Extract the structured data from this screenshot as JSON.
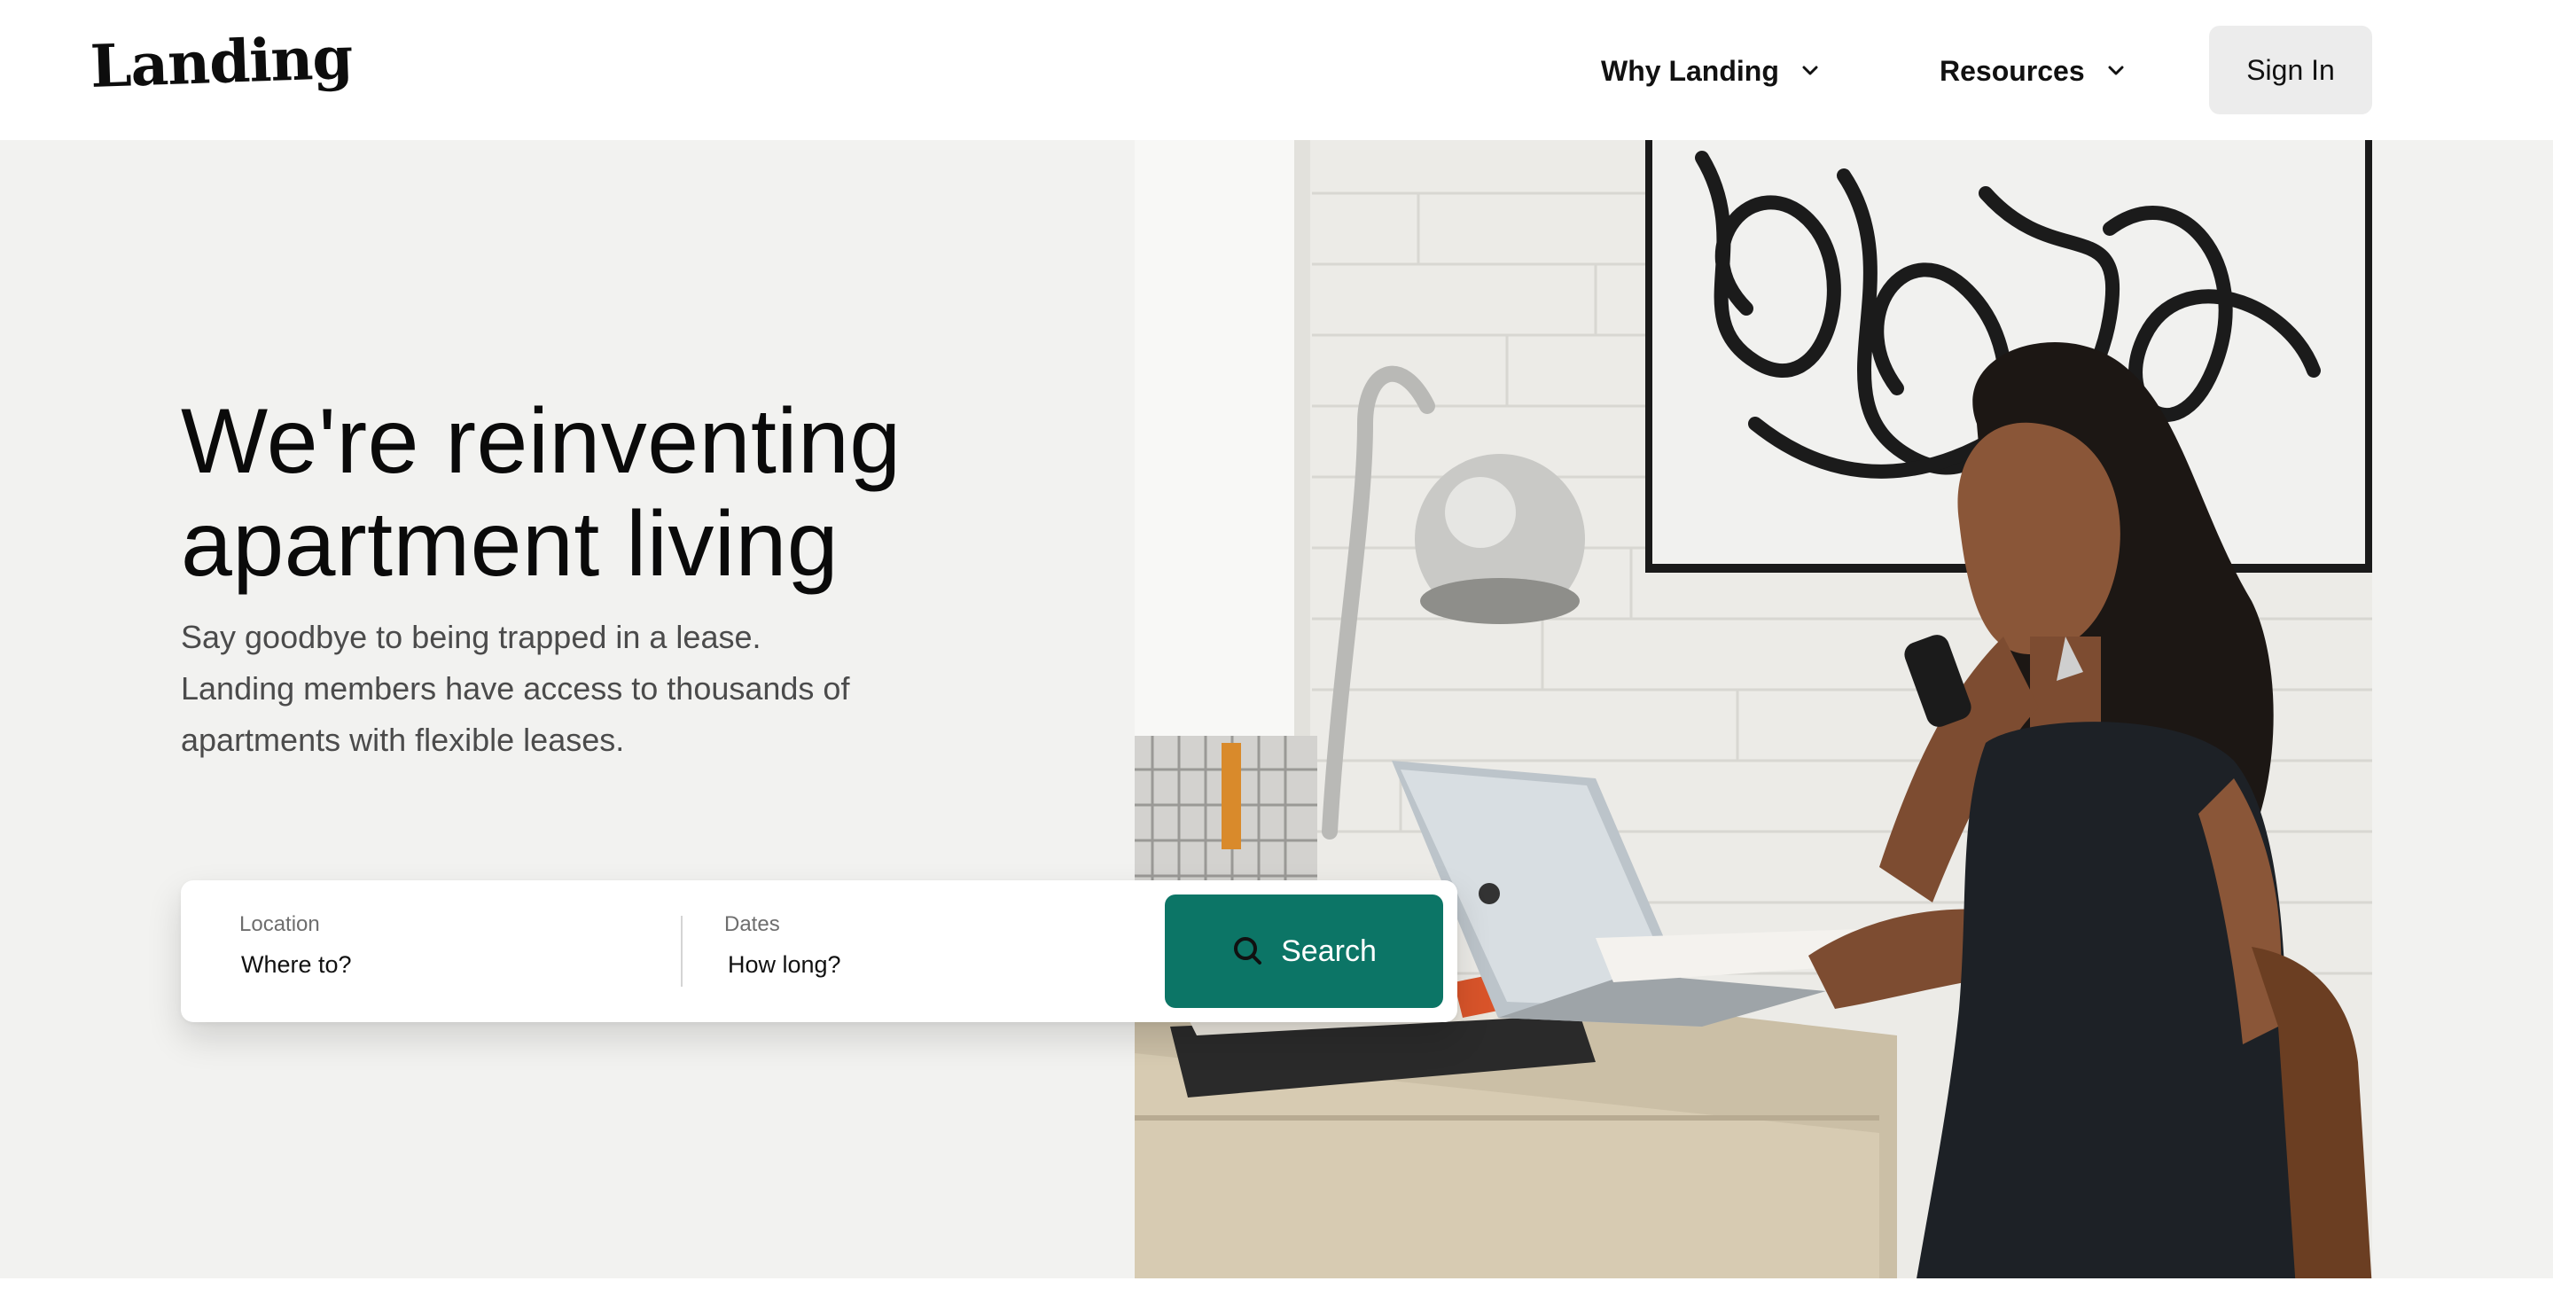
{
  "header": {
    "logo_text": "Landing",
    "nav": [
      {
        "label": "Why Landing",
        "icon": "chevron-down-icon"
      },
      {
        "label": "Resources",
        "icon": "chevron-down-icon"
      }
    ],
    "sign_in_label": "Sign In"
  },
  "hero": {
    "headline_line1": "We're reinventing",
    "headline_line2": "apartment living",
    "subtext": "Say goodbye to being trapped in a lease. Landing members have access to thousands of apartments with flexible leases."
  },
  "search": {
    "location_label": "Location",
    "location_placeholder": "Where to?",
    "dates_label": "Dates",
    "dates_placeholder": "How long?",
    "button_label": "Search",
    "button_icon": "search-icon"
  },
  "colors": {
    "accent": "#0c7566",
    "hero_bg": "#f2f2f0",
    "signin_bg": "#ececec"
  }
}
